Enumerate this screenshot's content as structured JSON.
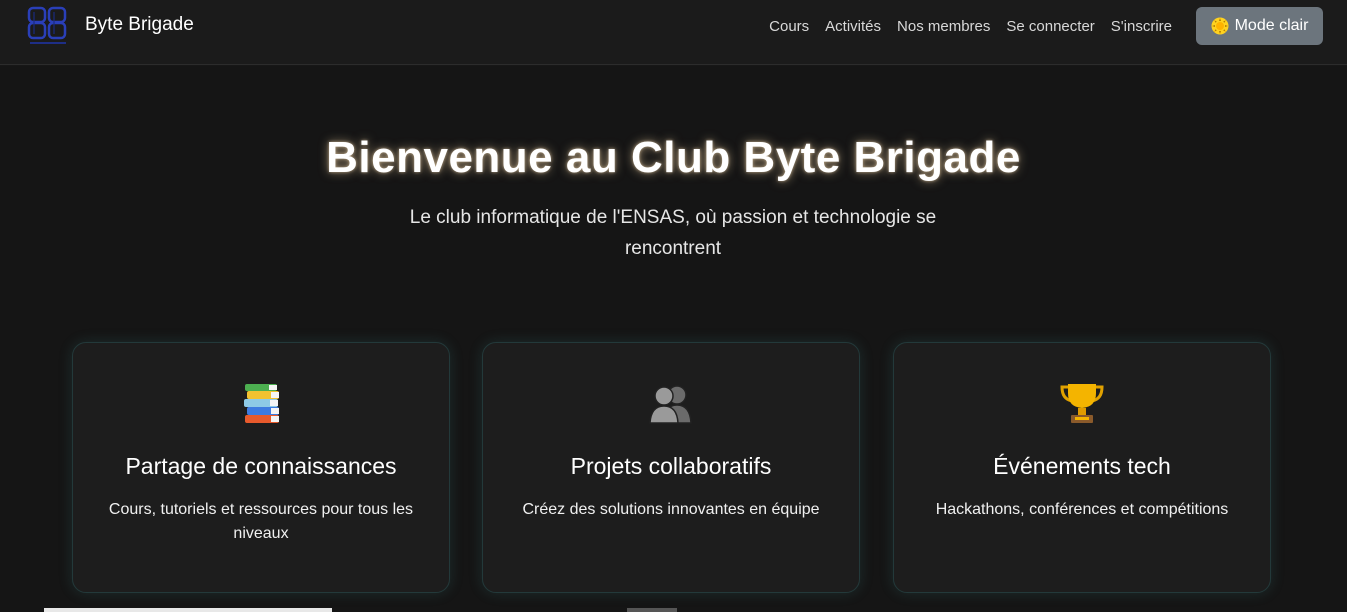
{
  "navbar": {
    "brand_name": "Byte Brigade",
    "links": [
      "Cours",
      "Activités",
      "Nos membres",
      "Se connecter",
      "S'inscrire"
    ],
    "mode_button_label": "Mode clair",
    "mode_button_icon": "sun-icon"
  },
  "hero": {
    "title": "Bienvenue au Club Byte Brigade",
    "subtitle": "Le club informatique de l'ENSAS, où passion et technologie se rencontrent"
  },
  "features": [
    {
      "icon": "books-icon",
      "title": "Partage de connaissances",
      "text": "Cours, tutoriels et ressources pour tous les niveaux"
    },
    {
      "icon": "people-icon",
      "title": "Projets collaboratifs",
      "text": "Créez des solutions innovantes en équipe"
    },
    {
      "icon": "trophy-icon",
      "title": "Événements tech",
      "text": "Hackathons, conférences et compétitions"
    }
  ],
  "colors": {
    "background": "#151515",
    "navbar": "#1b1b1b",
    "mode_button": "#6c757d",
    "card_border": "#23393a"
  }
}
